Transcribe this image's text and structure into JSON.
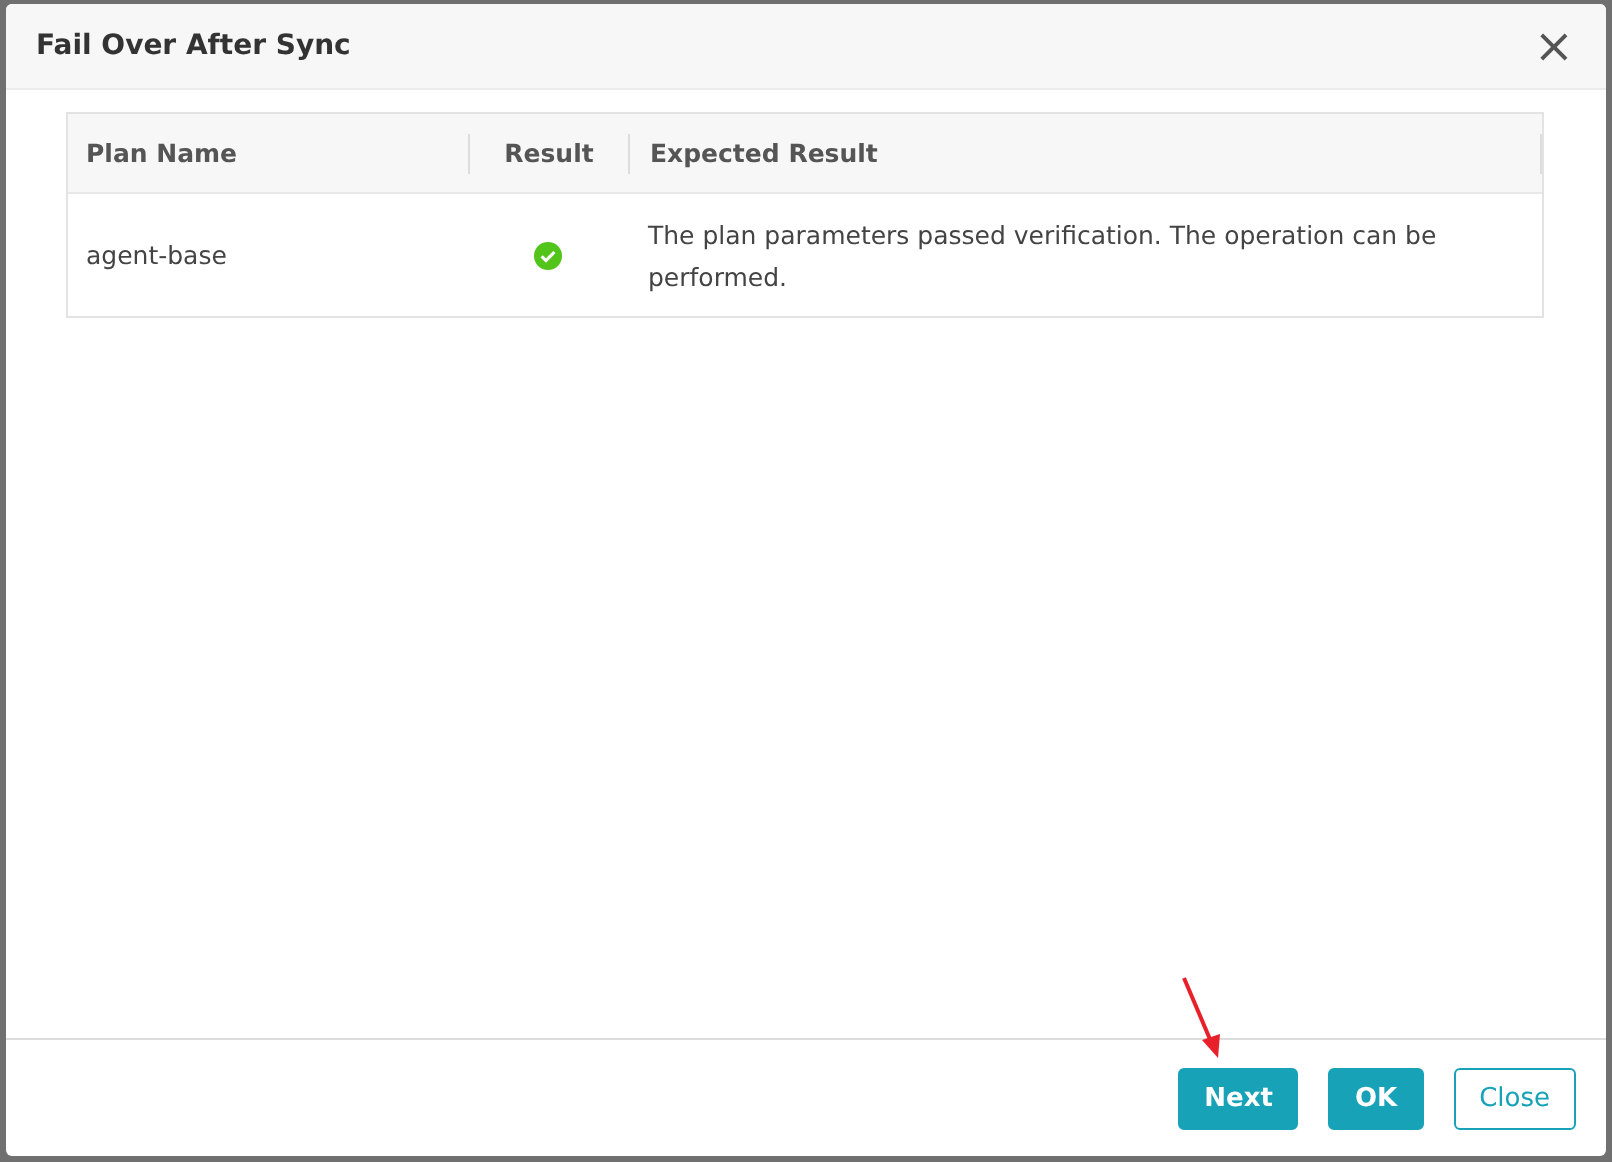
{
  "dialog": {
    "title": "Fail Over After Sync",
    "close_glyph": "×"
  },
  "table": {
    "columns": [
      "Plan Name",
      "Result",
      "Expected Result"
    ],
    "rows": [
      {
        "plan_name": "agent-base",
        "passed": true,
        "expected_result": "The plan parameters passed verification. The operation can be performed."
      }
    ]
  },
  "buttons": [
    {
      "label": "Next",
      "kind": "primary"
    },
    {
      "label": "OK",
      "kind": "primary"
    },
    {
      "label": "Close",
      "kind": "outline"
    }
  ],
  "annotation": {
    "kind": "arrow"
  }
}
